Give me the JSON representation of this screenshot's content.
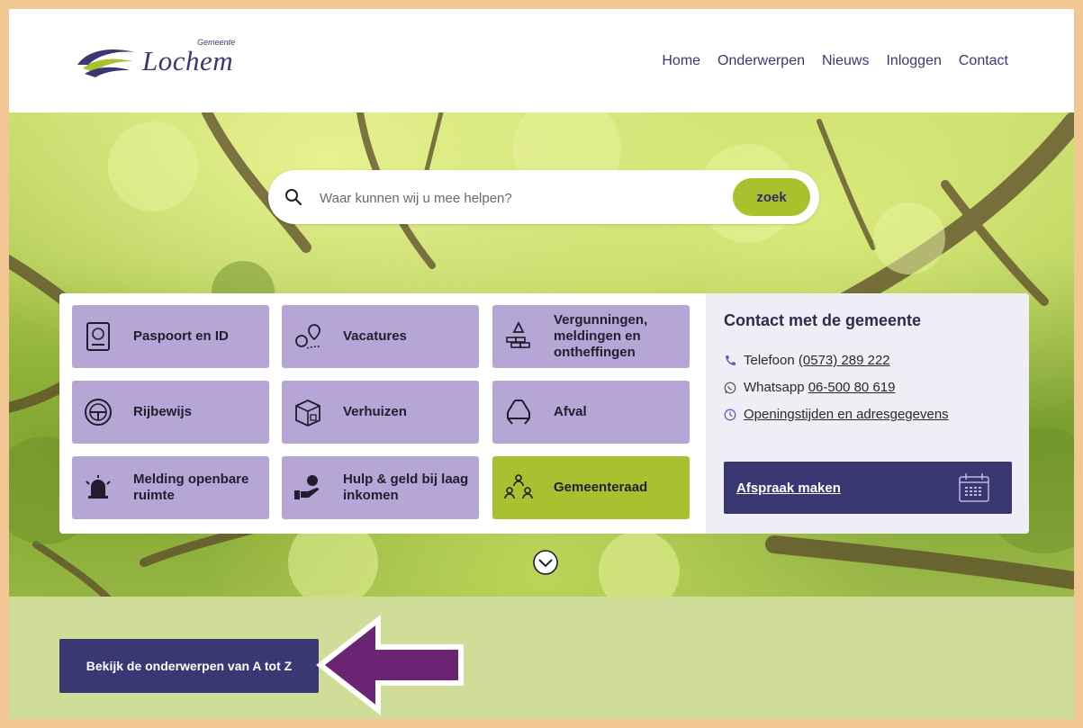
{
  "logo": {
    "word": "Lochem",
    "small": "Gemeente"
  },
  "nav": [
    "Home",
    "Onderwerpen",
    "Nieuws",
    "Inloggen",
    "Contact"
  ],
  "search": {
    "placeholder": "Waar kunnen wij u mee helpen?",
    "button": "zoek"
  },
  "tiles": [
    {
      "label": "Paspoort en ID",
      "icon": "passport-icon"
    },
    {
      "label": "Vacatures",
      "icon": "location-person-icon"
    },
    {
      "label": "Vergunningen, meldingen en ontheffingen",
      "icon": "construction-icon"
    },
    {
      "label": "Rijbewijs",
      "icon": "steering-wheel-icon"
    },
    {
      "label": "Verhuizen",
      "icon": "moving-box-icon"
    },
    {
      "label": "Afval",
      "icon": "recycle-icon"
    },
    {
      "label": "Melding openbare ruimte",
      "icon": "alarm-bell-icon"
    },
    {
      "label": "Hulp & geld bij laag inkomen",
      "icon": "money-hand-icon"
    },
    {
      "label": "Gemeenteraad",
      "icon": "council-people-icon"
    }
  ],
  "contact": {
    "title": "Contact met de gemeente",
    "phone_label": "Telefoon",
    "phone_number": "(0573) 289 222",
    "whatsapp_label": "Whatsapp",
    "whatsapp_number": "06-500 80 619",
    "hours_link": "Openingstijden en adresgegevens",
    "appointment_button": "Afspraak maken"
  },
  "az_button": "Bekijk de onderwerpen van A tot Z",
  "colors": {
    "brand": "#3a3873",
    "accent_green": "#a8c12d",
    "tile_purple": "#b5a6d5",
    "band_green": "#d0dd98",
    "arrow_purple": "#6b2373",
    "frame": "#f3c793"
  }
}
